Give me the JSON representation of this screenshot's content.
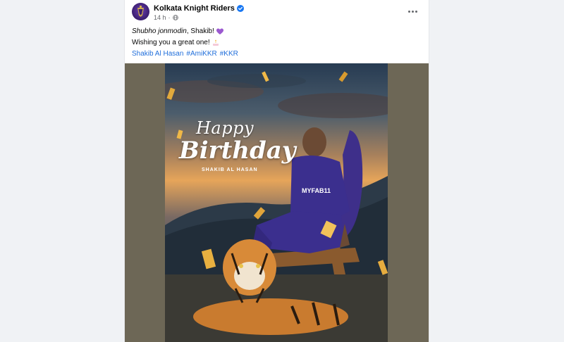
{
  "post": {
    "page_name": "Kolkata Knight Riders",
    "timestamp": "14 h",
    "separator": "·",
    "caption_italic": "Shubho jonmodin",
    "caption_rest": ", Shakib!",
    "line2": "Wishing you a great one!",
    "tag_person": "Shakib Al Hasan",
    "hashtags": [
      "#AmiKKR",
      "#KKR"
    ],
    "icons": {
      "verified": "verified-badge-icon",
      "audience": "globe-icon",
      "more": "more-options-icon",
      "heart": "purple-heart-emoji",
      "cake": "cake-emoji"
    }
  },
  "poster": {
    "happy": "Happy",
    "birthday": "Birthday",
    "player": "SHAKIB AL HASAN",
    "jersey_sponsor": "MYFAB11"
  },
  "colors": {
    "link": "#216fdb",
    "verified": "#1877f2",
    "kkr_purple": "#3a1d6e"
  }
}
